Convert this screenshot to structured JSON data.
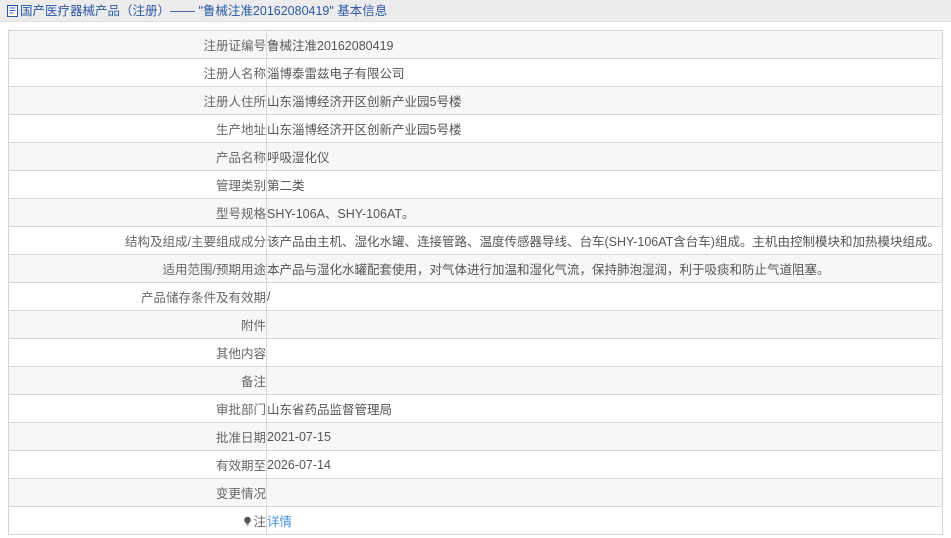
{
  "header": {
    "icon": "document-page-icon",
    "title": "国产医疗器械产品（注册）—— \"鲁械注准20162080419\" 基本信息",
    "background_color": "#ececec",
    "title_color": "#2b57a6"
  },
  "table": {
    "rows": [
      {
        "label": "注册证编号",
        "value": "鲁械注准20162080419"
      },
      {
        "label": "注册人名称",
        "value": "淄博泰雷兹电子有限公司"
      },
      {
        "label": "注册人住所",
        "value": "山东淄博经济开区创新产业园5号楼"
      },
      {
        "label": "生产地址",
        "value": "山东淄博经济开区创新产业园5号楼"
      },
      {
        "label": "产品名称",
        "value": "呼吸湿化仪"
      },
      {
        "label": "管理类别",
        "value": "第二类"
      },
      {
        "label": "型号规格",
        "value": "SHY-106A、SHY-106AT。"
      },
      {
        "label": "结构及组成/主要组成成分",
        "value": "该产品由主机、湿化水罐、连接管路、温度传感器导线、台车(SHY-106AT含台车)组成。主机由控制模块和加热模块组成。"
      },
      {
        "label": "适用范围/预期用途",
        "value": "本产品与湿化水罐配套使用，对气体进行加温和湿化气流，保持肺泡湿润，利于吸痰和防止气道阻塞。"
      },
      {
        "label": "产品储存条件及有效期",
        "value": "/"
      },
      {
        "label": "附件",
        "value": ""
      },
      {
        "label": "其他内容",
        "value": ""
      },
      {
        "label": "备注",
        "value": ""
      },
      {
        "label": "审批部门",
        "value": "山东省药品监督管理局"
      },
      {
        "label": "批准日期",
        "value": "2021-07-15"
      },
      {
        "label": "有效期至",
        "value": "2026-07-14"
      },
      {
        "label": "变更情况",
        "value": ""
      }
    ],
    "note_row": {
      "icon": "lightbulb-note-icon",
      "label": "注",
      "link_label": "详情",
      "link_color": "#4a90e2"
    },
    "stripe_color": "#f7f7f7",
    "border_color": "#d8d8d8",
    "label_color": "#666666",
    "value_color": "#555555"
  }
}
